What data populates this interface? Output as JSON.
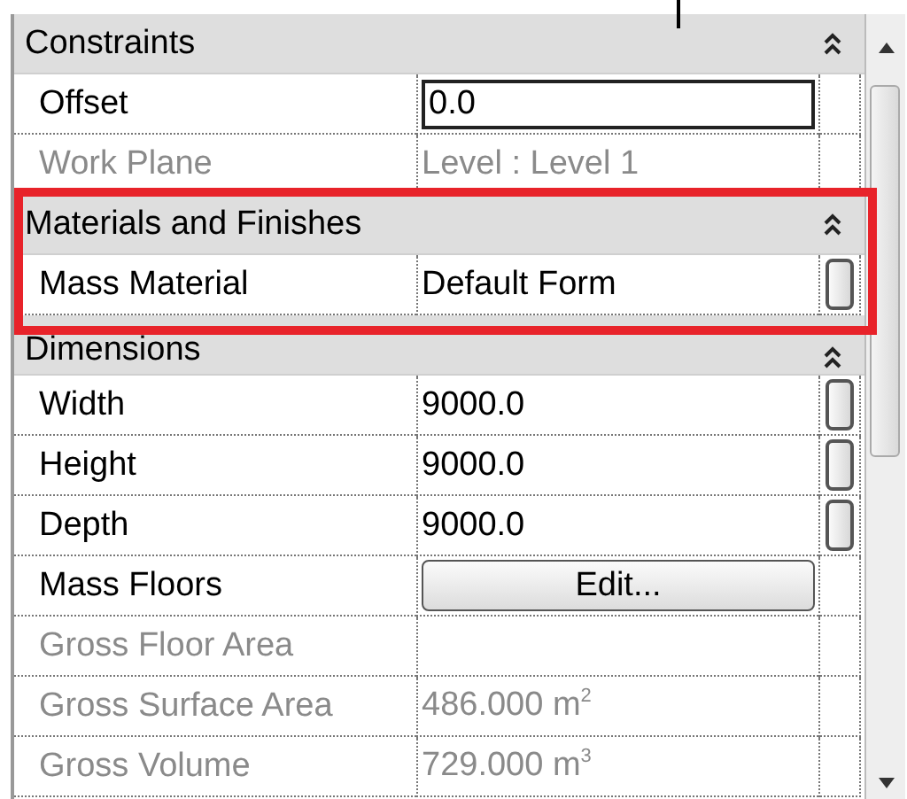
{
  "sections": [
    {
      "title": "Constraints",
      "expanded": true,
      "highlighted": false,
      "properties": [
        {
          "label": "Offset",
          "kind": "field",
          "value": "0.0",
          "disabled": false,
          "focused": true,
          "browse_button": false
        },
        {
          "label": "Work Plane",
          "kind": "field",
          "value": "Level : Level 1",
          "disabled": true,
          "focused": false,
          "browse_button": false
        }
      ]
    },
    {
      "title": "Materials and Finishes",
      "expanded": true,
      "highlighted": true,
      "properties": [
        {
          "label": "Mass Material",
          "kind": "field",
          "value": "Default Form",
          "disabled": false,
          "focused": false,
          "browse_button": true
        }
      ]
    },
    {
      "title": "Dimensions",
      "expanded": true,
      "highlighted": false,
      "properties": [
        {
          "label": "Width",
          "kind": "field",
          "value": "9000.0",
          "disabled": false,
          "focused": false,
          "browse_button": true
        },
        {
          "label": "Height",
          "kind": "field",
          "value": "9000.0",
          "disabled": false,
          "focused": false,
          "browse_button": true
        },
        {
          "label": "Depth",
          "kind": "field",
          "value": "9000.0",
          "disabled": false,
          "focused": false,
          "browse_button": true
        },
        {
          "label": "Mass Floors",
          "kind": "button",
          "value": "Edit...",
          "disabled": false,
          "focused": false,
          "browse_button": false
        },
        {
          "label": "Gross Floor Area",
          "kind": "field",
          "disabled": true,
          "focused": false,
          "browse_button": false
        },
        {
          "label": "Gross Surface Area",
          "kind": "field",
          "value": "486.000 m$^{2}$",
          "disabled": true,
          "focused": false,
          "browse_button": false
        },
        {
          "label": "Gross Volume",
          "kind": "field",
          "value": "729.000 m$^{3}$",
          "disabled": true,
          "focused": false,
          "browse_button": false
        }
      ]
    }
  ]
}
